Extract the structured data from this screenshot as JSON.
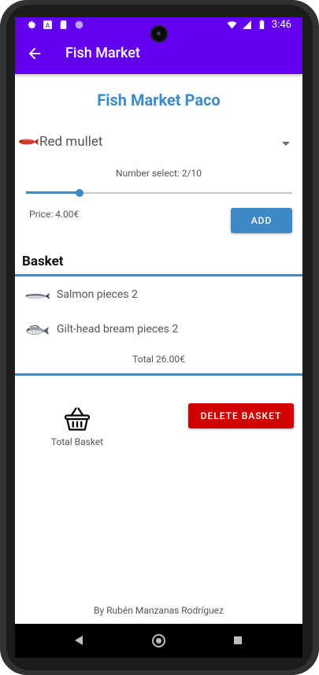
{
  "status_bar": {
    "time": "3:46",
    "icons": [
      "gear-icon",
      "a-icon",
      "sd-card-icon",
      "circle-icon",
      "wifi-icon",
      "signal-icon",
      "battery-icon"
    ]
  },
  "app_bar": {
    "title": "Fish Market",
    "color": "#6200ee"
  },
  "main": {
    "shop_title": "Fish Market Paco",
    "fish_select": {
      "value": "Red mullet"
    },
    "number_select_text": "Number select: 2/10",
    "slider": {
      "value": 2,
      "max": 10
    },
    "price_text": "Price: 4.00€",
    "add_button_label": "ADD"
  },
  "basket": {
    "title": "Basket",
    "items": [
      {
        "label": "Salmon pieces 2",
        "icon": "salmon-icon"
      },
      {
        "label": "Gilt-head bream pieces 2",
        "icon": "bream-icon"
      }
    ],
    "total_text": "Total 26.00€"
  },
  "actions": {
    "total_basket_label": "Total Basket",
    "delete_button_label": "DELETE BASKET"
  },
  "footer": {
    "author": "By Rubén Manzanas Rodríguez"
  },
  "colors": {
    "accent": "#3f8ac6",
    "danger": "#d00000",
    "app_bar": "#6200ee"
  }
}
